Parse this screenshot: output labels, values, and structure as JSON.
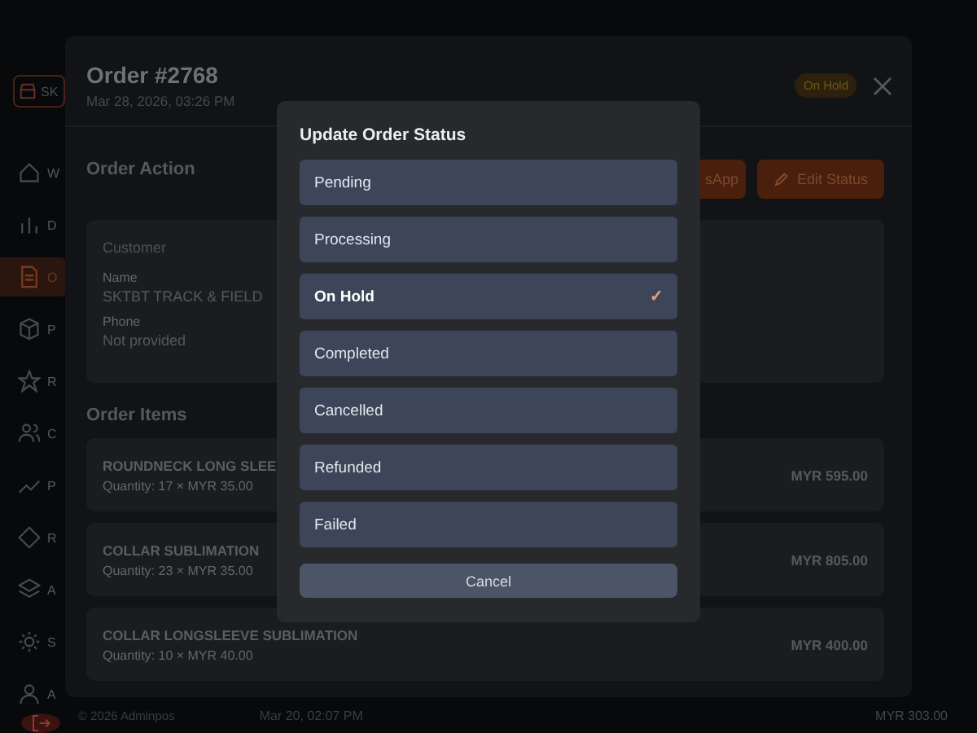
{
  "sidebar": {
    "top_button": "SK",
    "items": [
      {
        "kind": "home",
        "label": "W",
        "selected": false
      },
      {
        "kind": "chart",
        "label": "D",
        "selected": false
      },
      {
        "kind": "document",
        "label": "O",
        "selected": true
      },
      {
        "kind": "box",
        "label": "P",
        "selected": false
      },
      {
        "kind": "star",
        "label": "R",
        "selected": false
      },
      {
        "kind": "users",
        "label": "C",
        "selected": false
      },
      {
        "kind": "trend",
        "label": "P",
        "selected": false
      },
      {
        "kind": "diamond",
        "label": "R",
        "selected": false
      },
      {
        "kind": "layers",
        "label": "A",
        "selected": false
      },
      {
        "kind": "gear",
        "label": "S",
        "selected": false
      },
      {
        "kind": "user",
        "label": "A",
        "selected": false
      }
    ]
  },
  "order": {
    "title": "Order #2768",
    "date": "Mar 28, 2026, 03:26 PM",
    "status_badge": "On Hold",
    "action_title": "Order Action",
    "buttons": [
      {
        "kind": "whatsapp",
        "label": "sApp"
      },
      {
        "kind": "edit",
        "label": "Edit Status"
      }
    ],
    "customer": {
      "heading": "Customer",
      "name_label": "Name",
      "name": "SKTBT TRACK & FIELD",
      "phone_label": "Phone",
      "phone": "Not provided"
    },
    "items_title": "Order Items",
    "items": [
      {
        "name": "ROUNDNECK LONG SLEE",
        "detail": "Quantity: 17 × MYR 35.00",
        "total": "MYR 595.00"
      },
      {
        "name": "COLLAR SUBLIMATION",
        "detail": "Quantity: 23 × MYR 35.00",
        "total": "MYR 805.00"
      },
      {
        "name": "COLLAR LONGSLEEVE SUBLIMATION",
        "detail": "Quantity: 10 × MYR 40.00",
        "total": "MYR 400.00"
      }
    ]
  },
  "footer": {
    "copyright": "© 2026 Adminpos",
    "date": "Mar 20, 02:07 PM",
    "amount": "MYR 303.00"
  },
  "status_dialog": {
    "title": "Update Order Status",
    "options": [
      {
        "label": "Pending",
        "selected": false
      },
      {
        "label": "Processing",
        "selected": false
      },
      {
        "label": "On Hold",
        "selected": true
      },
      {
        "label": "Completed",
        "selected": false
      },
      {
        "label": "Cancelled",
        "selected": false
      },
      {
        "label": "Refunded",
        "selected": false
      },
      {
        "label": "Failed",
        "selected": false
      }
    ],
    "check": "✓",
    "cancel": "Cancel"
  }
}
